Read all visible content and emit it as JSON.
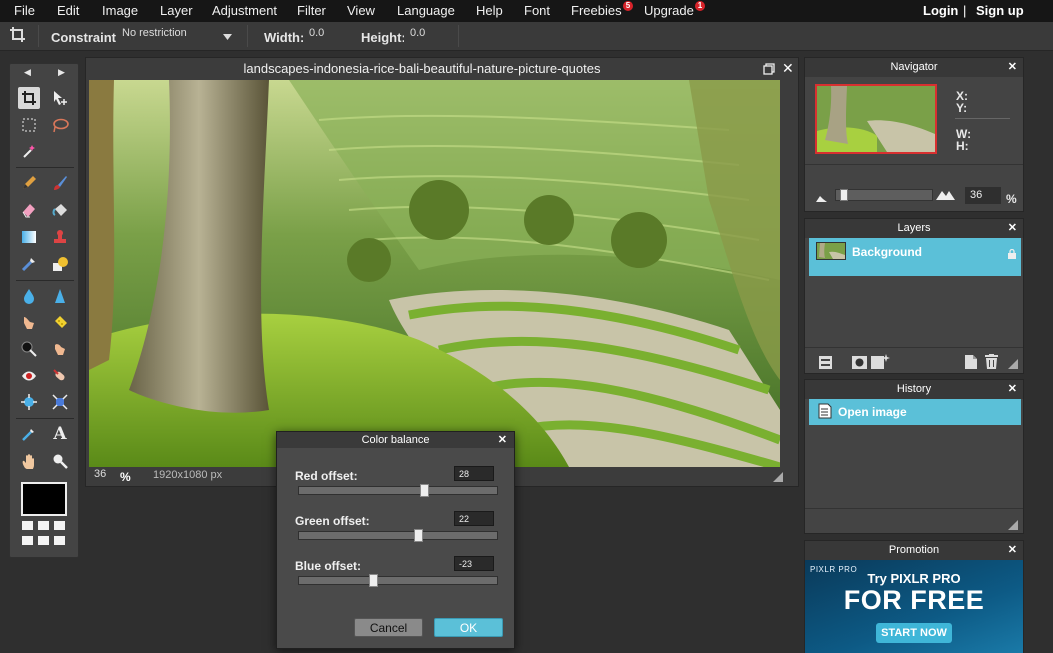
{
  "menu": {
    "items": [
      "File",
      "Edit",
      "Image",
      "Layer",
      "Adjustment",
      "Filter",
      "View",
      "Language",
      "Help",
      "Font",
      "Freebies",
      "Upgrade"
    ],
    "freebies_badge": "5",
    "upgrade_badge": "1",
    "login": "Login",
    "separator": "|",
    "signup": "Sign up"
  },
  "options": {
    "constraint_label": "Constraint:",
    "constraint_value": "No restriction",
    "width_label": "Width:",
    "width_value": "0.0",
    "height_label": "Height:",
    "height_value": "0.0"
  },
  "tools": {
    "icons": [
      "crop-icon",
      "move-icon",
      "marquee-icon",
      "lasso-icon",
      "magic-wand-icon",
      "pencil-icon",
      "brush-icon",
      "eraser-icon",
      "paint-bucket-icon",
      "gradient-icon",
      "clone-stamp-icon",
      "color-replace-icon",
      "drawing-icon",
      "blur-icon",
      "sharpen-icon",
      "smudge-icon",
      "sponge-icon",
      "dodge-icon",
      "burn-icon",
      "red-eye-icon",
      "spot-heal-icon",
      "bloat-icon",
      "pinch-icon",
      "color-picker-icon",
      "type-icon",
      "hand-icon",
      "zoom-icon"
    ],
    "foreground_color": "#000000",
    "background_color": "#ffffff"
  },
  "document": {
    "title": "landscapes-indonesia-rice-bali-beautiful-nature-picture-quotes",
    "zoom": "36",
    "zoom_unit": "%",
    "dimensions": "1920x1080 px"
  },
  "navigator": {
    "title": "Navigator",
    "x_label": "X:",
    "y_label": "Y:",
    "w_label": "W:",
    "h_label": "H:",
    "zoom": "36",
    "zoom_unit": "%",
    "zoom_slider_fraction": 0.05
  },
  "layers": {
    "title": "Layers",
    "items": [
      {
        "name": "Background",
        "locked": true
      }
    ]
  },
  "history": {
    "title": "History",
    "items": [
      "Open image"
    ]
  },
  "promotion": {
    "title": "Promotion",
    "brand": "PIXLR PRO",
    "headline": "Try PIXLR PRO",
    "big": "FOR FREE",
    "cta": "START NOW"
  },
  "dialog": {
    "title": "Color balance",
    "red_label": "Red offset:",
    "red_value": "28",
    "green_label": "Green offset:",
    "green_value": "22",
    "blue_label": "Blue offset:",
    "blue_value": "-23",
    "cancel": "Cancel",
    "ok": "OK"
  },
  "colors": {
    "accent": "#5bc0d8",
    "badge": "#d8232a"
  }
}
